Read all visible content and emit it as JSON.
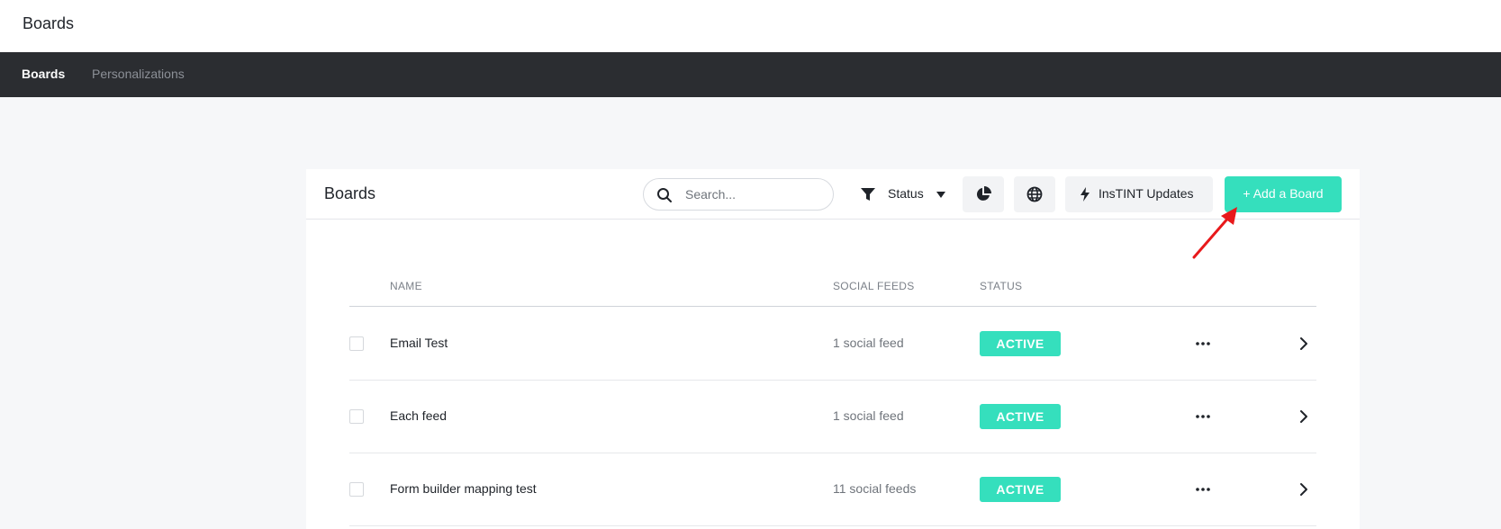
{
  "app": {
    "title": "Boards"
  },
  "nav": {
    "tabs": [
      {
        "label": "Boards",
        "active": true
      },
      {
        "label": "Personalizations",
        "active": false
      }
    ]
  },
  "card": {
    "title": "Boards",
    "toolbar": {
      "search_placeholder": "Search...",
      "search_value": "",
      "status_label": "Status",
      "analytics_icon": "pie-chart-icon",
      "globe_icon": "globe-icon",
      "updates_label": "InsTINT Updates",
      "add_label": "+ Add a Board"
    },
    "columns": {
      "name": "NAME",
      "feeds": "SOCIAL FEEDS",
      "status": "STATUS"
    },
    "rows": [
      {
        "name": "Email Test",
        "feeds": "1 social feed",
        "status": "ACTIVE"
      },
      {
        "name": "Each feed",
        "feeds": "1 social feed",
        "status": "ACTIVE"
      },
      {
        "name": "Form builder mapping test",
        "feeds": "11 social feeds",
        "status": "ACTIVE"
      }
    ]
  },
  "colors": {
    "accent": "#35dfbd",
    "navbar": "#2b2d31",
    "annotation_arrow": "#e8191b"
  }
}
